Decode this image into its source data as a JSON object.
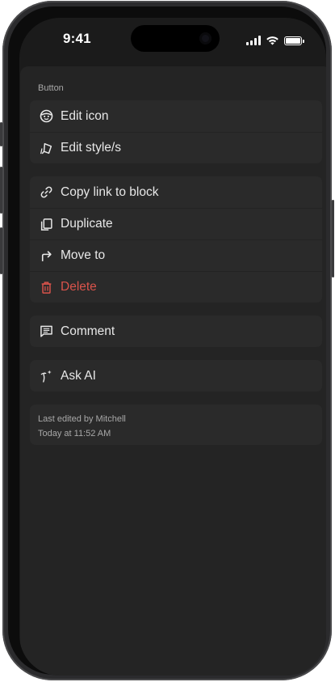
{
  "status_bar": {
    "time": "9:41"
  },
  "menu": {
    "section_title": "Button",
    "groups": [
      {
        "items": [
          {
            "label": "Edit icon",
            "icon": "smiley-face-icon"
          },
          {
            "label": "Edit style/s",
            "icon": "paint-style-icon"
          }
        ]
      },
      {
        "items": [
          {
            "label": "Copy link to block",
            "icon": "link-icon"
          },
          {
            "label": "Duplicate",
            "icon": "duplicate-icon"
          },
          {
            "label": "Move to",
            "icon": "move-arrow-icon"
          },
          {
            "label": "Delete",
            "icon": "trash-icon",
            "color": "#d9534b"
          }
        ]
      },
      {
        "items": [
          {
            "label": "Comment",
            "icon": "comment-icon"
          }
        ]
      },
      {
        "items": [
          {
            "label": "Ask AI",
            "icon": "ai-sparkle-icon"
          }
        ]
      }
    ],
    "footer": {
      "edited_by": "Last edited by Mitchell",
      "edited_at": "Today at 11:52 AM"
    }
  },
  "colors": {
    "sheet_background": "#242424",
    "group_background": "#2a2a2a",
    "text": "#e8e8e8",
    "muted_text": "#a8a8a8",
    "danger": "#d9534b"
  }
}
